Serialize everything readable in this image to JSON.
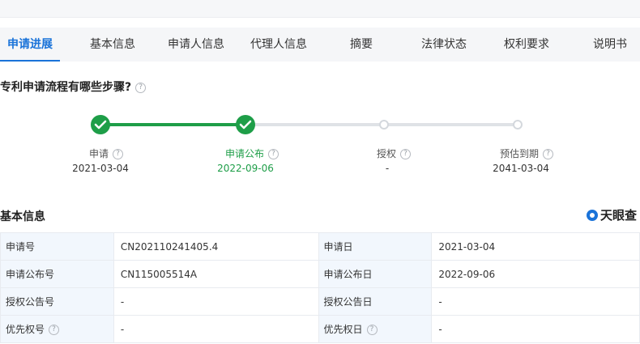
{
  "tabs": [
    "申请进展",
    "基本信息",
    "申请人信息",
    "代理人信息",
    "摘要",
    "法律状态",
    "权利要求",
    "说明书"
  ],
  "question": {
    "text": "专利申请流程有哪些步骤?",
    "help_icon": "question-circle-icon"
  },
  "timeline": {
    "steps": [
      {
        "label": "申请",
        "date": "2021-03-04",
        "status": "done"
      },
      {
        "label": "申请公布",
        "date": "2022-09-06",
        "status": "done"
      },
      {
        "label": "授权",
        "date": "-",
        "status": "pending"
      },
      {
        "label": "预估到期",
        "date": "2041-03-04",
        "status": "pending"
      }
    ],
    "colors": {
      "done": "#1e9e48",
      "pending": "#dfe2e6"
    }
  },
  "basic_info": {
    "title": "基本信息",
    "logo_text": "天眼查",
    "rows": [
      {
        "l1": "申请号",
        "v1": "CN202110241405.4",
        "l2": "申请日",
        "v2": "2021-03-04"
      },
      {
        "l1": "申请公布号",
        "v1": "CN115005514A",
        "l2": "申请公布日",
        "v2": "2022-09-06"
      },
      {
        "l1": "授权公告号",
        "v1": "-",
        "l2": "授权公告日",
        "v2": "-"
      },
      {
        "l1": "优先权号",
        "v1": "-",
        "l2": "优先权日",
        "v2": "-"
      }
    ]
  },
  "accent": "#1a73d9"
}
